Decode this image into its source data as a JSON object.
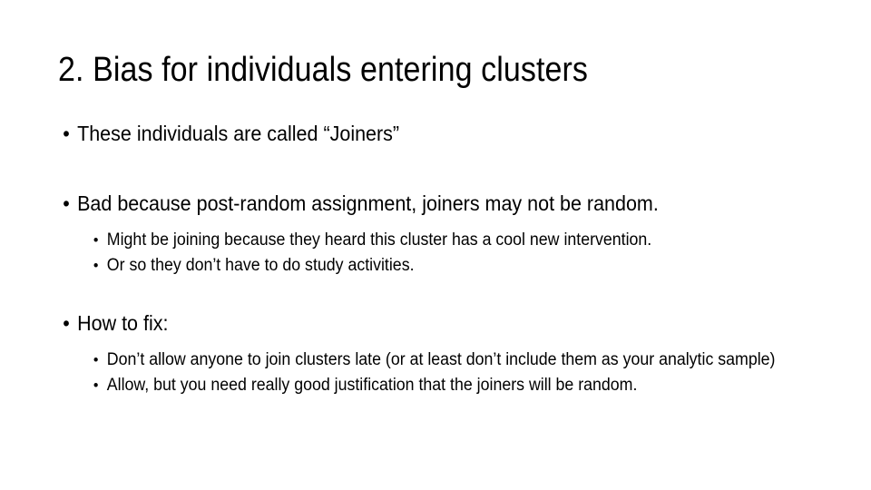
{
  "slide": {
    "title": "2. Bias for individuals entering clusters",
    "background_color": "#ffffff",
    "text_color": "#000000",
    "bullet_glyph": "•",
    "content": [
      {
        "level": 1,
        "text": "These individuals are called “Joiners”"
      },
      {
        "level": 1,
        "text": "Bad because post-random assignment, joiners may not be random."
      },
      {
        "level": 2,
        "text": "Might be joining because they heard this cluster has a cool new intervention."
      },
      {
        "level": 2,
        "text": "Or so they don’t have to do study activities."
      },
      {
        "level": 1,
        "text": "How to fix:"
      },
      {
        "level": 2,
        "text": "Don’t allow anyone to join clusters late (or at least don’t include them as your analytic sample)"
      },
      {
        "level": 2,
        "text": "Allow, but you need really good justification that the joiners will be random."
      }
    ]
  }
}
